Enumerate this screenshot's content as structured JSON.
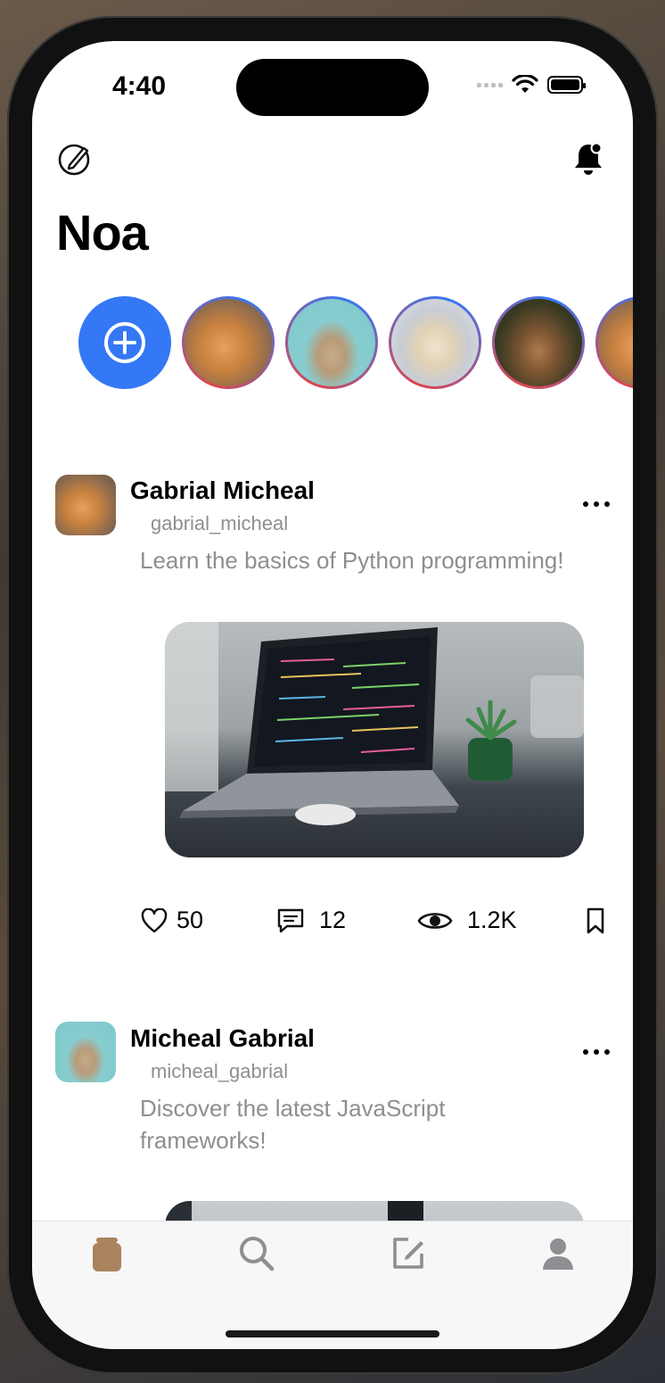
{
  "status_bar": {
    "time": "4:40"
  },
  "header": {
    "title": "Noa"
  },
  "stories": [
    {
      "name": "cat-orange"
    },
    {
      "name": "kitten-waving"
    },
    {
      "name": "polar-bear"
    },
    {
      "name": "deer"
    },
    {
      "name": "cat-orange-2"
    }
  ],
  "posts": [
    {
      "author": "Gabrial Micheal",
      "username": "gabrial_micheal",
      "text": "Learn the basics of Python programming!",
      "likes": "50",
      "comments": "12",
      "views": "1.2K"
    },
    {
      "author": "Micheal Gabrial",
      "username": "micheal_gabrial",
      "text": "Discover the latest JavaScript frameworks!"
    }
  ],
  "colors": {
    "accent": "#3478f6",
    "active_tab": "#a9835e",
    "muted_text": "#8e8e93"
  },
  "tabs": [
    "home-icon",
    "search-icon",
    "compose-icon",
    "profile-icon"
  ]
}
